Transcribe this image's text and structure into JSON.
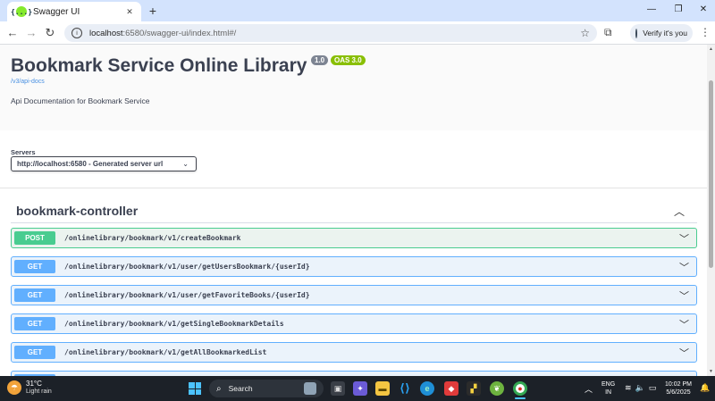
{
  "browser": {
    "tab_title": "Swagger UI",
    "tab_favicon": "{...}",
    "url_host": "localhost",
    "url_path": ":6580/swagger-ui/index.html#/",
    "profile_label": "Verify it's you"
  },
  "info": {
    "title": "Bookmark Service Online Library",
    "version_badge": "1.0",
    "oas_badge": "OAS 3.0",
    "spec_link": "/v3/api-docs",
    "description": "Api Documentation for Bookmark Service"
  },
  "servers": {
    "label": "Servers",
    "selected": "http://localhost:6580 - Generated server url"
  },
  "tag": {
    "name": "bookmark-controller"
  },
  "operations": [
    {
      "method": "POST",
      "path": "/onlinelibrary/bookmark/v1/createBookmark"
    },
    {
      "method": "GET",
      "path": "/onlinelibrary/bookmark/v1/user/getUsersBookmark/{userId}"
    },
    {
      "method": "GET",
      "path": "/onlinelibrary/bookmark/v1/user/getFavoriteBooks/{userId}"
    },
    {
      "method": "GET",
      "path": "/onlinelibrary/bookmark/v1/getSingleBookmarkDetails"
    },
    {
      "method": "GET",
      "path": "/onlinelibrary/bookmark/v1/getAllBookmarkedList"
    }
  ],
  "taskbar": {
    "weather_temp": "31°C",
    "weather_condition": "Light rain",
    "search_label": "Search",
    "lang_line1": "ENG",
    "lang_line2": "IN",
    "time": "10:02 PM",
    "date": "5/6/2025"
  },
  "colors": {
    "post": "#49cc90",
    "get": "#61affe",
    "text": "#3b4151"
  }
}
